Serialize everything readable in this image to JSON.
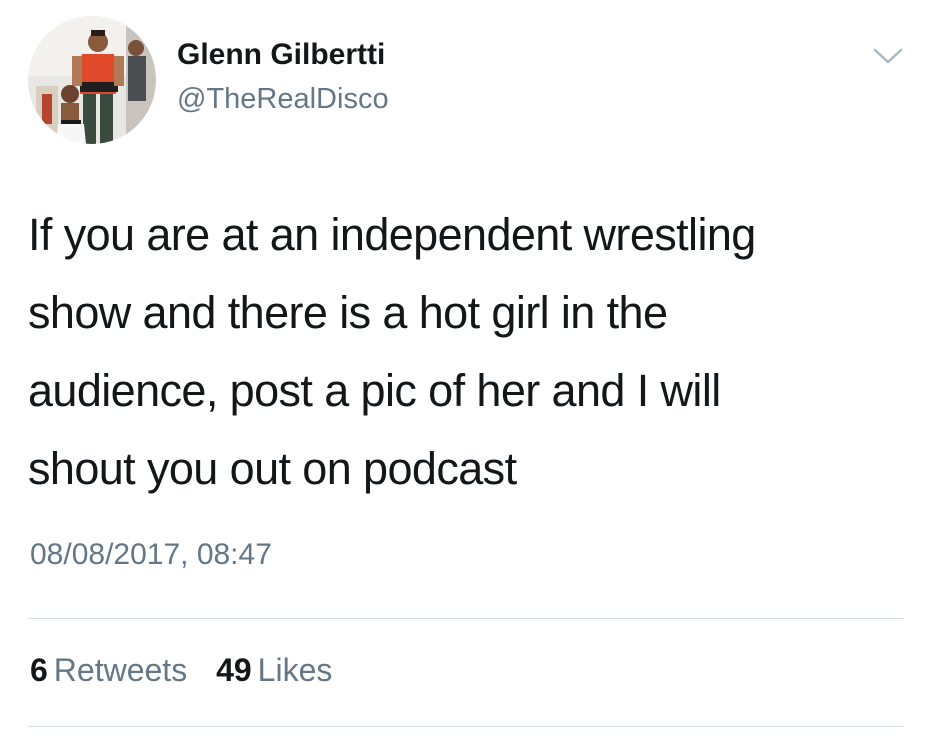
{
  "tweet": {
    "author": {
      "display_name": "Glenn Gilbertti",
      "handle": "@TheRealDisco",
      "avatar": "profile-photo"
    },
    "text_lines": [
      "If you are at an independent wrestling",
      "show and there is a hot girl in the",
      "audience, post a pic of her and I will",
      "shout you out on podcast"
    ],
    "timestamp": "08/08/2017, 08:47",
    "stats": {
      "retweets_count": "6",
      "retweets_label": "Retweets",
      "likes_count": "49",
      "likes_label": "Likes"
    },
    "menu_icon": "chevron-down-icon"
  },
  "colors": {
    "text": "#14171a",
    "secondary": "#657786",
    "divider": "#d8dde2"
  }
}
